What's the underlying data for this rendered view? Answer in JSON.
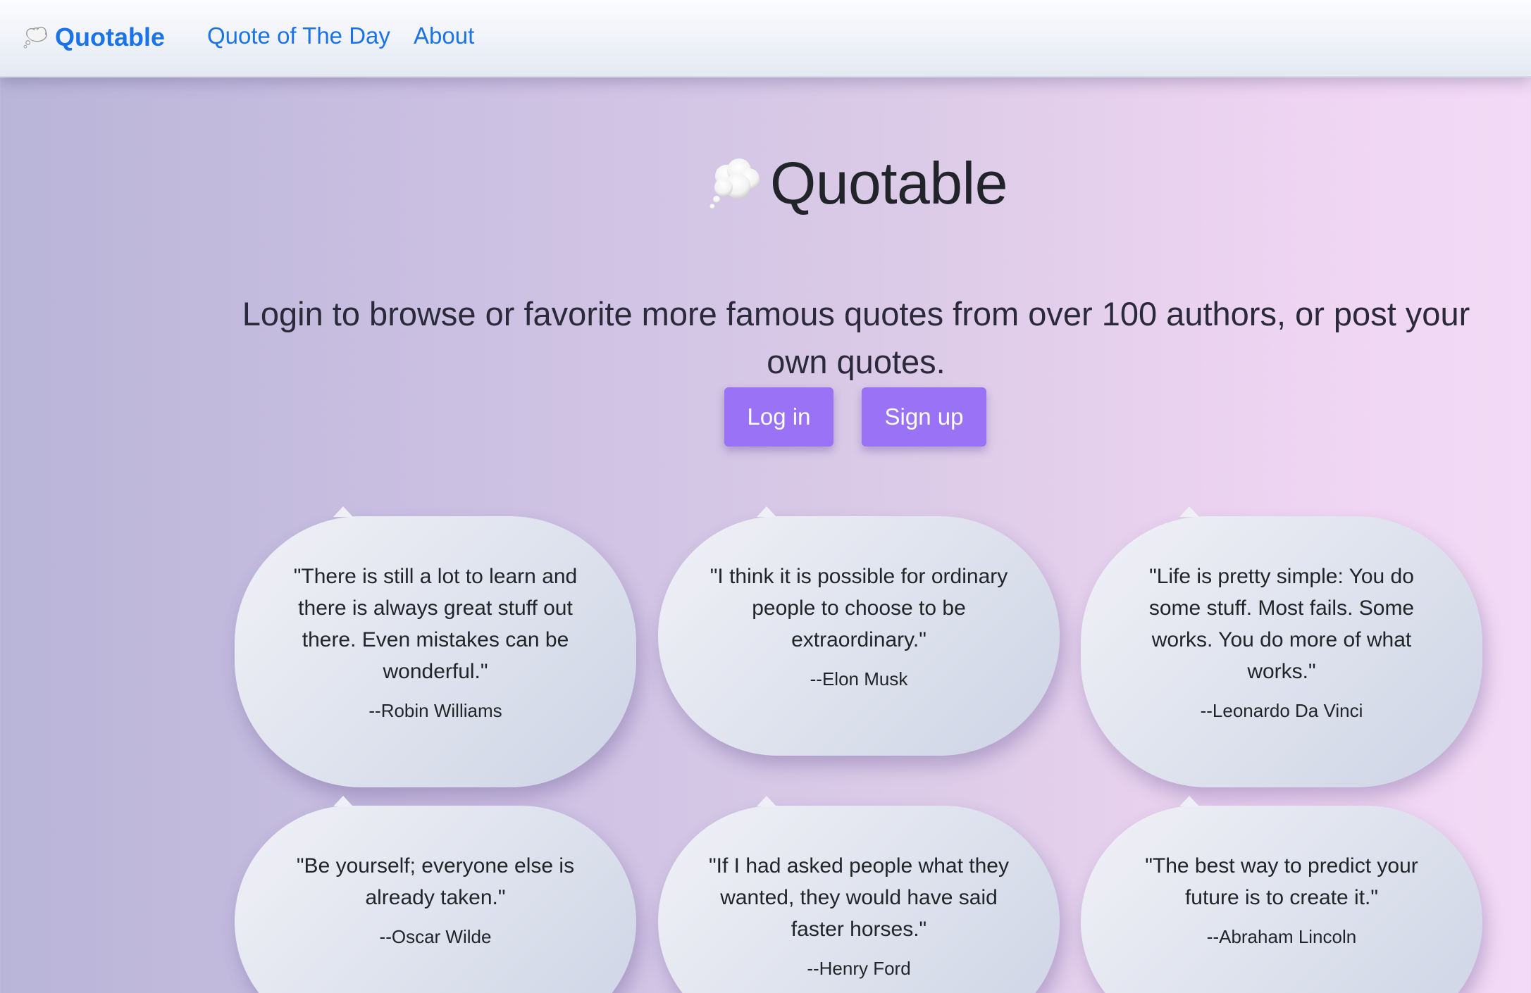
{
  "navbar": {
    "brand": "Quotable",
    "brand_icon": "thought-balloon-icon",
    "links": [
      "Quote of The Day",
      "About"
    ]
  },
  "hero": {
    "title": "Quotable",
    "title_icon": "thought-balloon-icon",
    "lead": "Login to browse or favorite more famous quotes from over 100 authors, or post your own quotes.",
    "login_label": "Log in",
    "signup_label": "Sign up"
  },
  "quotes": [
    {
      "text": "\"There is still a lot to learn and there is always great stuff out there. Even mistakes can be wonderful.\"",
      "author": "--Robin Williams"
    },
    {
      "text": "\"I think it is possible for ordinary people to choose to be extraordinary.\"",
      "author": "--Elon Musk"
    },
    {
      "text": "\"Life is pretty simple: You do some stuff. Most fails. Some works. You do more of what works.\"",
      "author": "--Leonardo Da Vinci"
    },
    {
      "text": "\"Be yourself; everyone else is already taken.\"",
      "author": "--Oscar Wilde"
    },
    {
      "text": "\"If I had asked people what they wanted, they would have said faster horses.\"",
      "author": "--Henry Ford"
    },
    {
      "text": "\"The best way to predict your future is to create it.\"",
      "author": "--Abraham Lincoln"
    }
  ],
  "colors": {
    "link": "#1a73e8",
    "button": "#9a72f5",
    "text": "#212529"
  }
}
